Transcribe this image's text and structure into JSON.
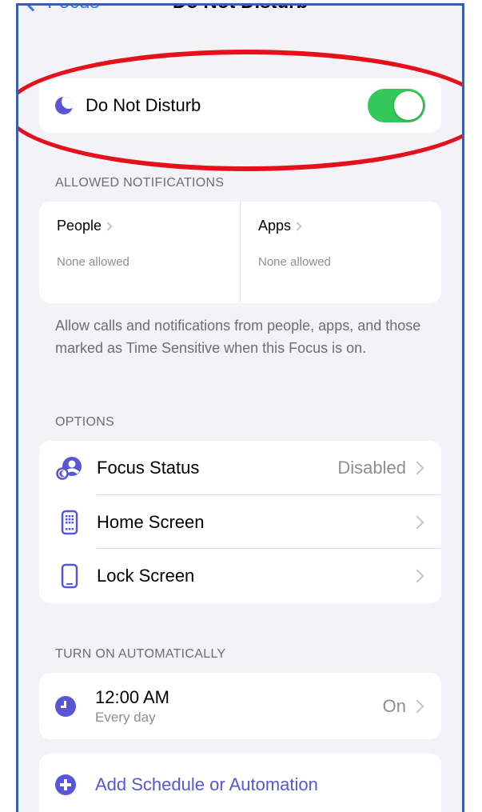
{
  "nav": {
    "back_label": "Focus",
    "title": "Do Not Disturb"
  },
  "dnd": {
    "label": "Do Not Disturb",
    "enabled": true,
    "icon": "moon-icon"
  },
  "allowed": {
    "header": "ALLOWED NOTIFICATIONS",
    "people": {
      "title": "People",
      "value": "None allowed"
    },
    "apps": {
      "title": "Apps",
      "value": "None allowed"
    },
    "footer": "Allow calls and notifications from people, apps, and those marked as Time Sensitive when this Focus is on."
  },
  "options": {
    "header": "OPTIONS",
    "items": [
      {
        "label": "Focus Status",
        "value": "Disabled",
        "icon": "focus-status-icon"
      },
      {
        "label": "Home Screen",
        "value": "",
        "icon": "home-screen-icon"
      },
      {
        "label": "Lock Screen",
        "value": "",
        "icon": "lock-screen-icon"
      }
    ]
  },
  "automation": {
    "header": "TURN ON AUTOMATICALLY",
    "schedule": {
      "time": "12:00 AM",
      "repeat": "Every day",
      "state": "On"
    },
    "add_label": "Add Schedule or Automation"
  },
  "colors": {
    "accent": "#5856d6",
    "toggle_on": "#34c759",
    "link": "#3478f6",
    "annotation": "#e5101a"
  }
}
